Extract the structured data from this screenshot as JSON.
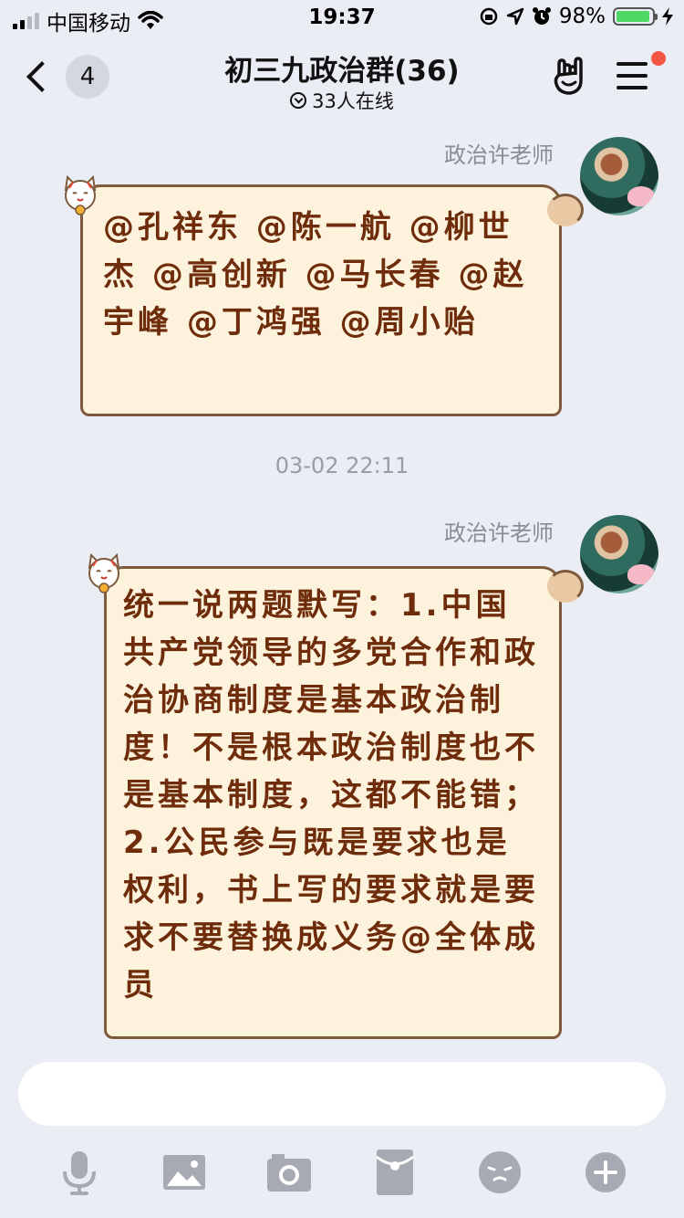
{
  "status_bar": {
    "carrier": "中国移动",
    "time": "19:37",
    "battery": "98%"
  },
  "nav": {
    "back_count": "4",
    "title": "初三九政治群(36)",
    "subtitle": "33人在线"
  },
  "messages": [
    {
      "sender": "政治许老师",
      "text": "@孔祥东 @陈一航 @柳世杰 @高创新 @马长春 @赵宇峰 @丁鸿强 @周小贻"
    },
    {
      "sender": "政治许老师",
      "text": "统一说两题默写：1.中国共产党领导的多党合作和政治协商制度是基本政治制度！不是根本政治制度也不是基本制度，这都不能错；2.公民参与既是要求也是权利，书上写的要求就是要求不要替换成义务@全体成员"
    }
  ],
  "timestamp": "03-02 22:11",
  "input": {
    "placeholder": "",
    "value": ""
  },
  "toolbar_icons": [
    "microphone-icon",
    "image-icon",
    "camera-icon",
    "red-packet-icon",
    "emoji-icon",
    "plus-icon"
  ],
  "colors": {
    "background": "#ebedf4",
    "bubble_fill": "#fdf2dc",
    "bubble_border": "#7e5a3c",
    "bubble_text": "#6e2c0b",
    "badge_red": "#f25643",
    "battery_green": "#4cd964",
    "toolbar_icon": "#a7aab3"
  }
}
